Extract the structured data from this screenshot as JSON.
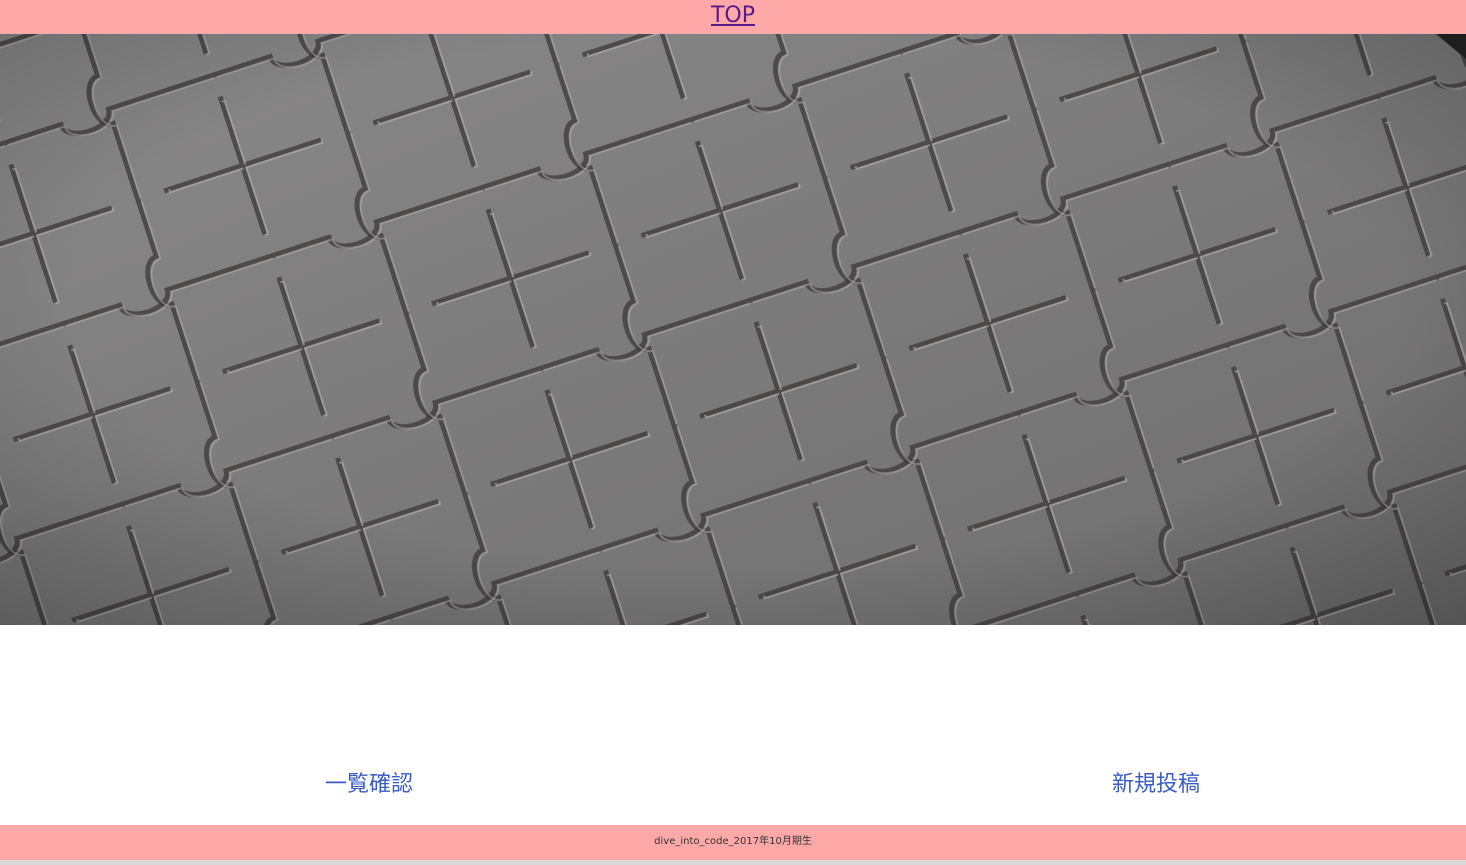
{
  "header": {
    "top_link": "TOP"
  },
  "hero": {
    "image": "jigsaw-puzzle-photo"
  },
  "nav": {
    "list_link": "一覧確認",
    "new_post_link": "新規投稿"
  },
  "footer": {
    "text": "dive_into_code_2017年10月期生"
  },
  "colors": {
    "header_bg": "#ffa8a8",
    "footer_bg": "#ffa8a8",
    "link": "#3b5cc4",
    "visited_link": "#551a8b"
  }
}
